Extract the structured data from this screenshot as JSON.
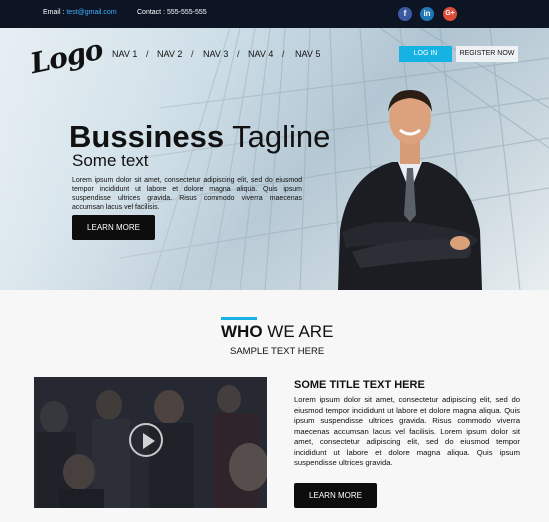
{
  "topbar": {
    "email_label": "Email :",
    "email_value": "test@gmail.com",
    "contact": "Contact : 555-555-555",
    "social": [
      "f",
      "in",
      "G+"
    ]
  },
  "header": {
    "logo": "Logo",
    "nav": [
      "NAV 1",
      "NAV 2",
      "NAV 3",
      "NAV 4",
      "NAV 5"
    ],
    "separator": "/",
    "login": "LOG IN",
    "register": "REGISTER NOW"
  },
  "hero": {
    "tagline_bold": "Bussiness",
    "tagline_light": "Tagline",
    "subtitle": "Some text",
    "text": "Lorem ipsum dolor sit amet, consectetur adipiscing elit, sed do eiusmod tempor incididunt ut labore et dolore magna aliqua. Quis ipsum suspendisse ultrices gravida. Risus commodo viverra maecenas accumsan lacus vel facilisis.",
    "button": "LEARN MORE"
  },
  "who": {
    "heading_bold": "WHO",
    "heading_light": "WE ARE",
    "sample": "SAMPLE TEXT HERE"
  },
  "content": {
    "title": "SOME TITLE TEXT HERE",
    "text": "Lorem ipsum dolor sit amet, consectetur adipiscing elit, sed do eiusmod tempor incididunt ut labore et dolore magna aliqua. Quis ipsum suspendisse ultrices gravida. Risus commodo viverra maecenas accumsan lacus vel facilisis. Lorem ipsum dolor sit amet, consectetur adipiscing elit, sed do eiusmod tempor incididunt ut labore et dolore magna aliqua. Quis ipsum suspendisse ultrices gravida.",
    "button": "LEARN MORE"
  },
  "colors": {
    "accent": "#16b2e4",
    "topbar": "#0d1424",
    "button_dark": "#0d0d0d"
  }
}
